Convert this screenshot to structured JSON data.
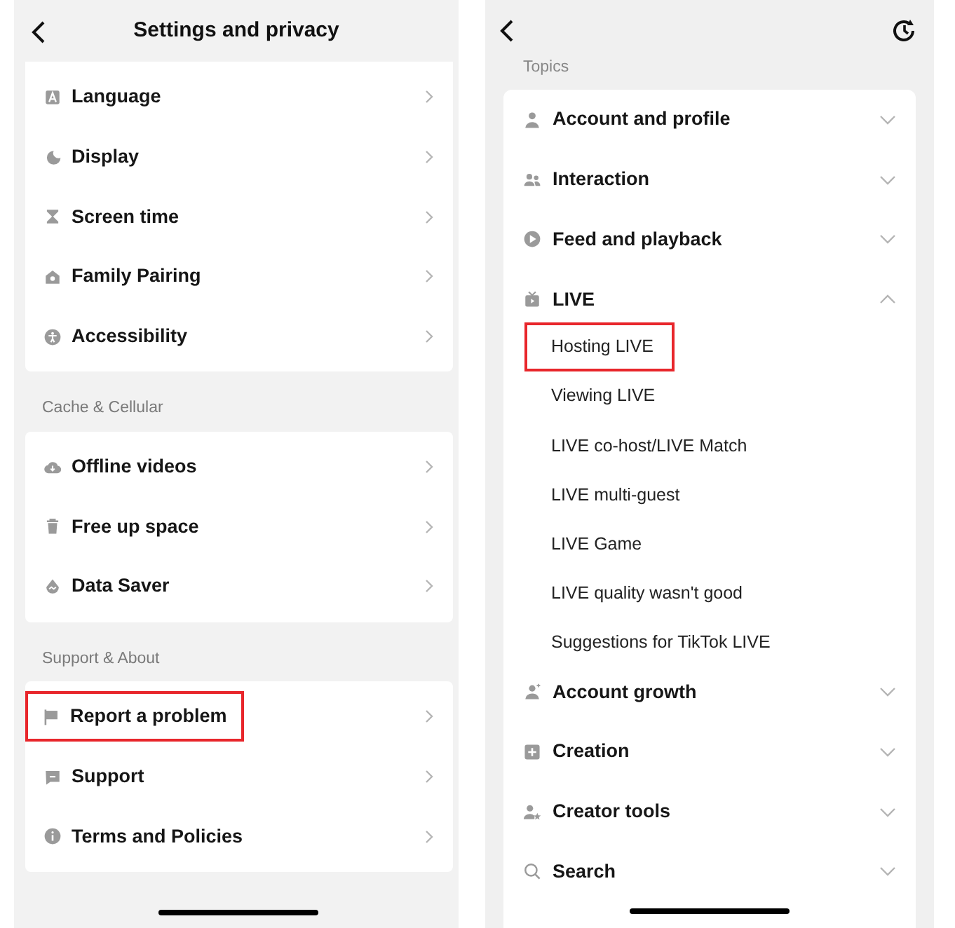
{
  "settings": {
    "title": "Settings and privacy",
    "sections": [
      {
        "items": [
          {
            "label": "Language",
            "kind": "lang",
            "highlighted": false
          },
          {
            "label": "Display",
            "kind": "moon",
            "highlighted": false
          },
          {
            "label": "Screen time",
            "kind": "hourglass",
            "highlighted": false
          },
          {
            "label": "Family Pairing",
            "kind": "home",
            "highlighted": false
          },
          {
            "label": "Accessibility",
            "kind": "access",
            "highlighted": false
          }
        ]
      },
      {
        "heading": "Cache & Cellular",
        "items": [
          {
            "label": "Offline videos",
            "kind": "cloud",
            "highlighted": false
          },
          {
            "label": "Free up space",
            "kind": "trash",
            "highlighted": false
          },
          {
            "label": "Data Saver",
            "kind": "drop",
            "highlighted": false
          }
        ]
      },
      {
        "heading": "Support & About",
        "items": [
          {
            "label": "Report a problem",
            "kind": "flag",
            "highlighted": true
          },
          {
            "label": "Support",
            "kind": "chat",
            "highlighted": false
          },
          {
            "label": "Terms and Policies",
            "kind": "info",
            "highlighted": false
          }
        ]
      }
    ]
  },
  "report": {
    "section_heading": "Topics",
    "topics": [
      {
        "label": "Account and profile",
        "kind": "person",
        "expanded": false
      },
      {
        "label": "Interaction",
        "kind": "people",
        "expanded": false
      },
      {
        "label": "Feed and playback",
        "kind": "play",
        "expanded": false
      },
      {
        "label": "LIVE",
        "kind": "tv",
        "expanded": true,
        "children": [
          {
            "label": "Hosting LIVE",
            "highlighted": true
          },
          {
            "label": "Viewing LIVE",
            "highlighted": false
          },
          {
            "label": "LIVE co-host/LIVE Match",
            "highlighted": false
          },
          {
            "label": "LIVE multi-guest",
            "highlighted": false
          },
          {
            "label": "LIVE Game",
            "highlighted": false
          },
          {
            "label": "LIVE quality wasn't good",
            "highlighted": false
          },
          {
            "label": "Suggestions for TikTok LIVE",
            "highlighted": false
          }
        ]
      },
      {
        "label": "Account growth",
        "kind": "personplus",
        "expanded": false
      },
      {
        "label": "Creation",
        "kind": "plus",
        "expanded": false
      },
      {
        "label": "Creator tools",
        "kind": "personstar",
        "expanded": false
      },
      {
        "label": "Search",
        "kind": "search",
        "expanded": false
      }
    ]
  }
}
